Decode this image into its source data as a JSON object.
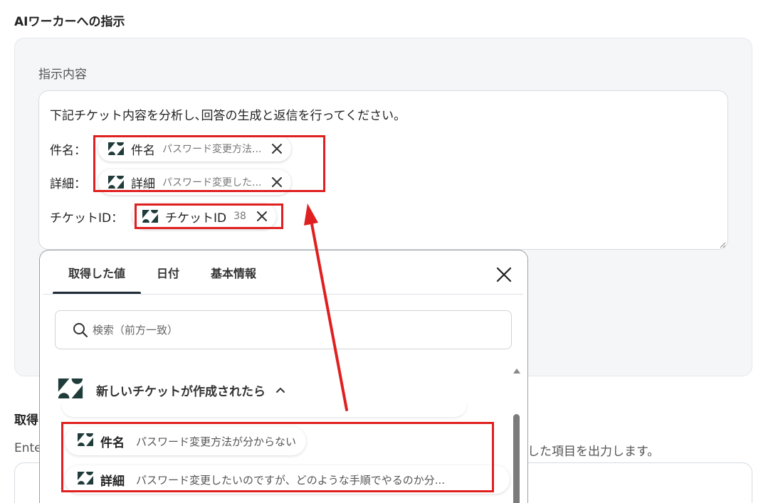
{
  "section": {
    "title": "AIワーカーへの指示"
  },
  "instruction": {
    "field_label": "指示内容",
    "line1": "下記チケット内容を分析し､回答の生成と返信を行ってください。",
    "line_subject_label": "件名：",
    "line_detail_label": "詳細：",
    "line_ticket_label": "チケットID：",
    "chips": [
      {
        "name": "件名",
        "value": "パスワード変更方法..."
      },
      {
        "name": "詳細",
        "value": "パスワード変更した..."
      },
      {
        "name": "チケットID",
        "value": "38"
      }
    ]
  },
  "popup": {
    "tabs": [
      "取得した値",
      "日付",
      "基本情報"
    ],
    "active_tab": 0,
    "search_placeholder": "検索（前方一致）",
    "group_title": "新しいチケットが作成されたら",
    "items": [
      {
        "name": "件名",
        "value": "パスワード変更方法が分からない"
      },
      {
        "name": "詳細",
        "value": "パスワード変更したいのですが、どのような手順でやるのか分..."
      }
    ]
  },
  "background": {
    "label_partial": "取得",
    "desc_left_partial": "Ente",
    "desc_right_partial": "した項目を出力します。"
  },
  "colors": {
    "highlight": "#e02020",
    "zendesk": "#1f3b3a",
    "tab_underline": "#1f2a36"
  },
  "icons": {
    "chip": "zendesk-icon",
    "close": "close-icon",
    "search": "search-icon",
    "chevron": "chevron-up-icon"
  }
}
